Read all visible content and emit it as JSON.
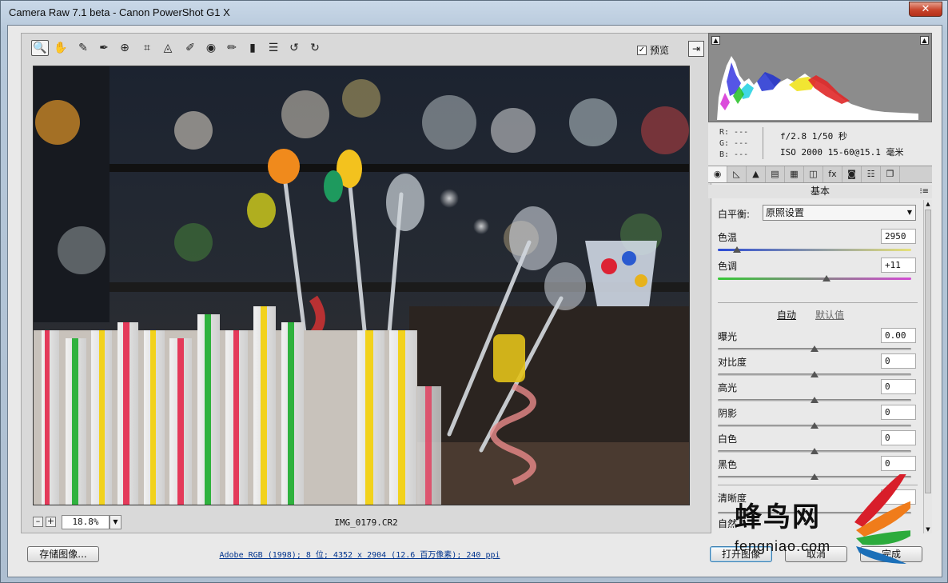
{
  "window": {
    "title": "Camera Raw 7.1 beta -  Canon PowerShot G1 X",
    "close_glyph": "✕"
  },
  "toolbar": {
    "tools": [
      {
        "name": "zoom-tool",
        "glyph": "🔍"
      },
      {
        "name": "hand-tool",
        "glyph": "✋"
      },
      {
        "name": "white-balance-tool",
        "glyph": "✎"
      },
      {
        "name": "color-sampler-tool",
        "glyph": "✒"
      },
      {
        "name": "target-adjustment-tool",
        "glyph": "⊕"
      },
      {
        "name": "crop-tool",
        "glyph": "⌗"
      },
      {
        "name": "straighten-tool",
        "glyph": "◬"
      },
      {
        "name": "spot-removal-tool",
        "glyph": "✐"
      },
      {
        "name": "red-eye-tool",
        "glyph": "◉"
      },
      {
        "name": "adjustment-brush-tool",
        "glyph": "✏"
      },
      {
        "name": "graduated-filter-tool",
        "glyph": "▮"
      },
      {
        "name": "preferences-tool",
        "glyph": "☰"
      },
      {
        "name": "rotate-ccw-tool",
        "glyph": "↺"
      },
      {
        "name": "rotate-cw-tool",
        "glyph": "↻"
      }
    ],
    "preview_label": "预览",
    "preview_checked": "✓",
    "fullscreen_glyph": "⇥"
  },
  "status": {
    "zoom_minus": "–",
    "zoom_plus": "+",
    "zoom_value": "18.8%",
    "zoom_arrow": "▼",
    "filename": "IMG_0179.CR2"
  },
  "histogram": {
    "clip_shadow": "▲",
    "clip_highlight": "▲"
  },
  "info": {
    "r": "R:  ---",
    "g": "G:  ---",
    "b": "B:  ---",
    "exif_line1": "f/2.8  1/50 秒",
    "exif_line2": "ISO 2000  15-60@15.1 毫米"
  },
  "tabs": [
    "◉",
    "◺",
    "▲",
    "▤",
    "▦",
    "◫",
    "fx",
    "◙",
    "☷",
    "❐"
  ],
  "panel": {
    "title": "基本",
    "menu_glyph": "⁝≡",
    "white_balance_label": "白平衡:",
    "white_balance_value": "原照设置",
    "select_arrow": "▼",
    "auto_label": "自动",
    "default_label": "默认值",
    "sliders": [
      {
        "label": "色温",
        "value": "2950",
        "pos": 0.1,
        "track": "temp"
      },
      {
        "label": "色调",
        "value": "+11",
        "pos": 0.56,
        "track": "tint"
      },
      {
        "label": "曝光",
        "value": "0.00",
        "pos": 0.5,
        "track": "plain"
      },
      {
        "label": "对比度",
        "value": "0",
        "pos": 0.5,
        "track": "plain"
      },
      {
        "label": "高光",
        "value": "0",
        "pos": 0.5,
        "track": "plain"
      },
      {
        "label": "阴影",
        "value": "0",
        "pos": 0.5,
        "track": "plain"
      },
      {
        "label": "白色",
        "value": "0",
        "pos": 0.5,
        "track": "plain"
      },
      {
        "label": "黑色",
        "value": "0",
        "pos": 0.5,
        "track": "plain"
      }
    ],
    "clarity_label": "清晰度",
    "vibrance_label": "自然"
  },
  "bottom": {
    "save_label": "存储图像...",
    "workflow": "Adobe RGB (1998); 8 位; 4352 x 2904 (12.6 百万像素); 240 ppi",
    "open_label": "打开图像",
    "cancel_label": "取消",
    "done_label": "完成"
  },
  "watermark": {
    "cn": "蜂鸟网",
    "en": "fengniao.com"
  },
  "colors": {
    "accent": "#3c7fb1",
    "link": "#00338d"
  }
}
